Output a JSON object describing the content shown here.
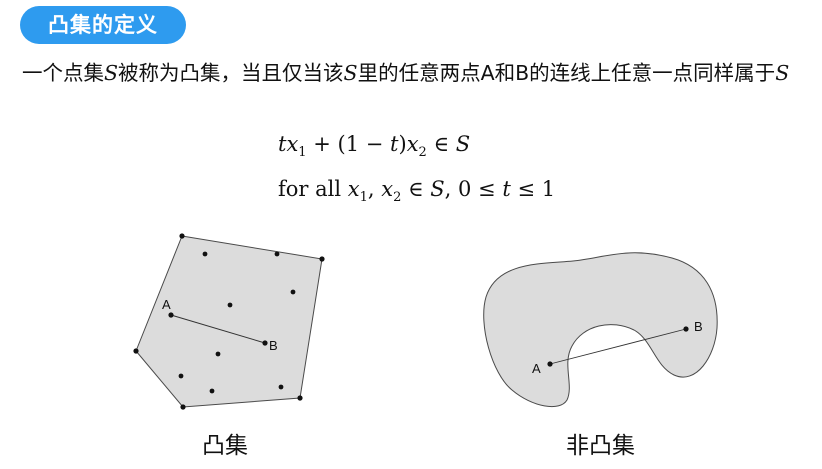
{
  "title": "凸集的定义",
  "definition": {
    "part1": "一个点集",
    "var1": "S",
    "part2": "被称为凸集，当且仅当该",
    "var2": "S",
    "part3": "里的任意两点A和B的连线上任意一点同样属于",
    "var3": "S"
  },
  "formula_line1": {
    "t1": "t",
    "x": "x",
    "sub1": "1",
    "mid": " + (1 − ",
    "t2": "t",
    "close": ")",
    "x2": "x",
    "sub2": "2",
    "tail": " ∈ ",
    "S": "S"
  },
  "formula_line2": {
    "lead": "for all ",
    "x1": "x",
    "sub1": "1",
    "comma": ", ",
    "x2": "x",
    "sub2": "2",
    "mid": " ∈ ",
    "S": "S",
    "rest": ", 0 ≤ ",
    "t": "t",
    "end": " ≤ 1"
  },
  "convex_figure": {
    "label_a": "A",
    "label_b": "B",
    "caption": "凸集"
  },
  "nonconvex_figure": {
    "label_a": "A",
    "label_b": "B",
    "caption": "非凸集"
  }
}
